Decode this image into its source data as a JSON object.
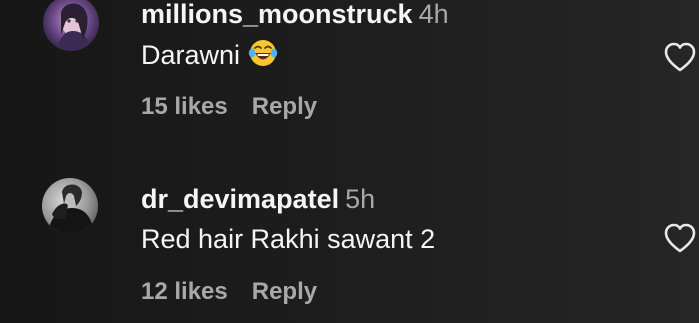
{
  "comments": [
    {
      "username": "millions_moonstruck",
      "time": "4h",
      "text": "Darawni",
      "emoji": "laughing-crying-emoji",
      "likes": "15 likes",
      "reply": "Reply"
    },
    {
      "username": "dr_devimapatel",
      "time": "5h",
      "text": "Red hair Rakhi sawant 2",
      "likes": "12 likes",
      "reply": "Reply"
    }
  ],
  "colors": {
    "background": "#1b1b1b",
    "primary_text": "#f5f5f5",
    "secondary_text": "#a8a8a8",
    "heart_outline": "#e8e8e8"
  }
}
